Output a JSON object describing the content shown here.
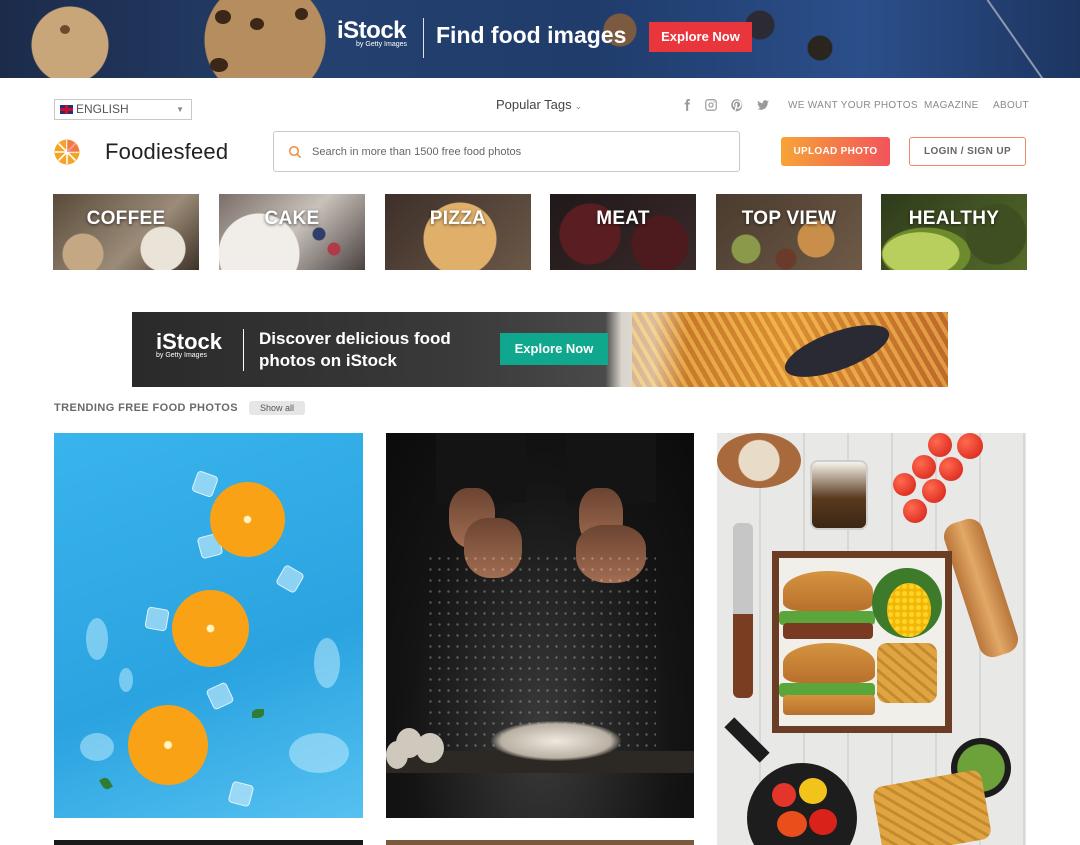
{
  "top_banner": {
    "logo": "iStock",
    "logo_sub": "by Getty Images",
    "title": "Find food images",
    "cta": "Explore Now",
    "cta_color": "#e8363c"
  },
  "header": {
    "language": "ENGLISH",
    "popular_tags": "Popular Tags",
    "social_icons": [
      "facebook-icon",
      "instagram-icon",
      "pinterest-icon",
      "twitter-icon"
    ],
    "links": [
      "WE WANT YOUR PHOTOS",
      "MAGAZINE",
      "ABOUT"
    ],
    "brand": "Foodiesfeed",
    "search_placeholder": "Search in more than 1500 free food photos",
    "upload_label": "UPLOAD PHOTO",
    "login_label": "LOGIN / SIGN UP",
    "accent_gradient": [
      "#f6a436",
      "#f2545b"
    ]
  },
  "categories": [
    {
      "label": "COFFEE"
    },
    {
      "label": "CAKE"
    },
    {
      "label": "PIZZA"
    },
    {
      "label": "MEAT"
    },
    {
      "label": "TOP VIEW"
    },
    {
      "label": "HEALTHY"
    }
  ],
  "mid_ad": {
    "logo": "iStock",
    "logo_sub": "by Getty Images",
    "title": "Discover delicious food photos on iStock",
    "cta": "Explore Now",
    "cta_color": "#0fa88e"
  },
  "trending": {
    "title": "TRENDING FREE FOOD PHOTOS",
    "show_all": "Show all"
  }
}
